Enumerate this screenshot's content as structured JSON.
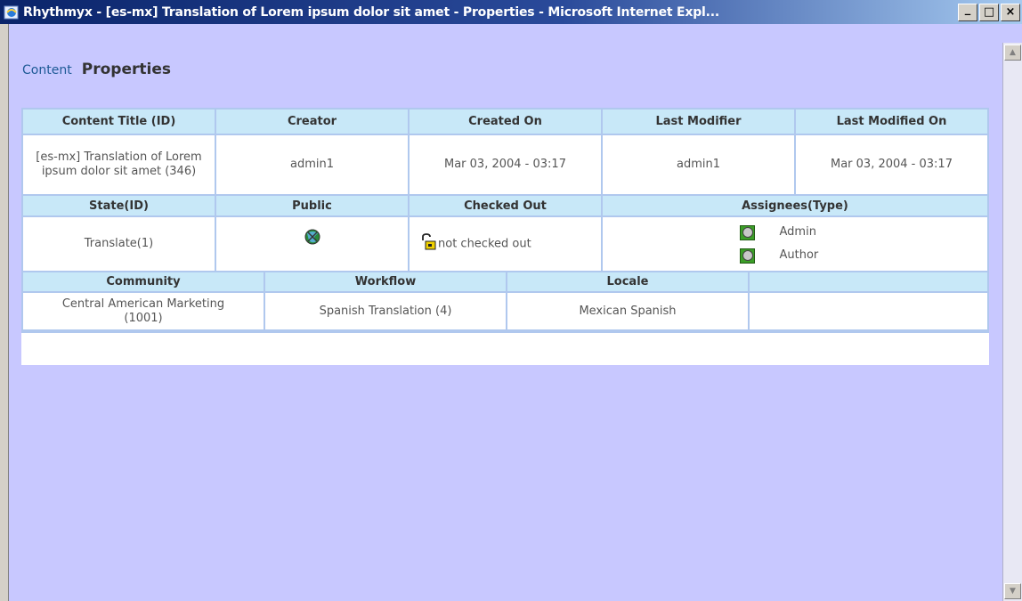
{
  "window": {
    "title": "Rhythmyx - [es-mx] Translation of Lorem ipsum dolor sit amet - Properties - Microsoft Internet Expl...",
    "minimize_label": "_",
    "maximize_label": "□",
    "close_label": "×"
  },
  "breadcrumb": {
    "content_link": "Content",
    "current": "Properties"
  },
  "table1": {
    "headers": [
      "Content Title (ID)",
      "Creator",
      "Created On",
      "Last Modifier",
      "Last Modified On"
    ],
    "row": [
      "[es-mx] Translation of Lorem ipsum dolor sit amet (346)",
      "admin1",
      "Mar 03, 2004 - 03:17",
      "admin1",
      "Mar 03, 2004 - 03:17"
    ]
  },
  "table2": {
    "headers": [
      "State(ID)",
      "Public",
      "Checked Out",
      "Assignees(Type)"
    ],
    "state": "Translate(1)",
    "public_icon": "globe-icon",
    "checkout_icon": "padlock-open-icon",
    "checked_out": "not checked out",
    "assignees": [
      "Admin",
      "Author"
    ]
  },
  "table3": {
    "headers": [
      "Community",
      "Workflow",
      "Locale",
      ""
    ],
    "row": [
      "Central American Marketing (1001)",
      "Spanish Translation (4)",
      "Mexican Spanish",
      ""
    ]
  },
  "colors": {
    "page_bg": "#c8c8ff",
    "header_bg": "#c8e8f8",
    "border": "#b0c8ee",
    "link": "#1e5a96"
  }
}
